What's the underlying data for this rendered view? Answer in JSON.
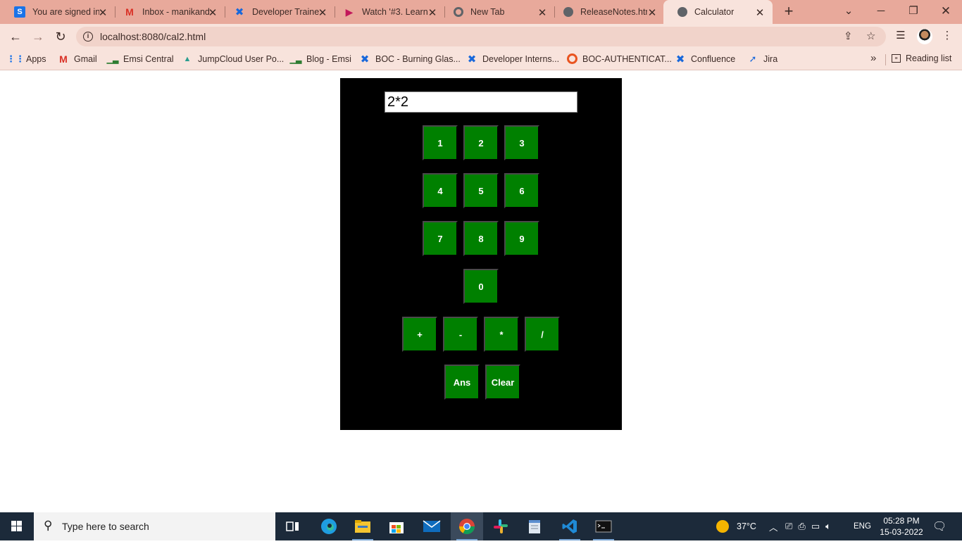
{
  "browser": {
    "tabs": [
      {
        "title": "You are signed in",
        "favicon": "S",
        "favicon_color": "#1a73e8"
      },
      {
        "title": "Inbox - manikand",
        "favicon": "M",
        "favicon_color": "#d93025"
      },
      {
        "title": "Developer Trainee",
        "favicon": "confluence-icon",
        "favicon_color": "#1868db"
      },
      {
        "title": "Watch '#3. Learn",
        "favicon": "play-icon",
        "favicon_color": "#c2185b"
      },
      {
        "title": "New Tab",
        "favicon": "chrome-icon",
        "favicon_color": "#5f6368"
      },
      {
        "title": "ReleaseNotes.htm",
        "favicon": "globe-icon",
        "favicon_color": "#5f6368"
      },
      {
        "title": "Calculator",
        "favicon": "globe-icon",
        "favicon_color": "#5f6368",
        "active": true
      }
    ],
    "new_tab": "+",
    "url": "localhost:8080/cal2.html",
    "bookmarks": [
      {
        "label": "Apps"
      },
      {
        "label": "Gmail"
      },
      {
        "label": "Emsi Central"
      },
      {
        "label": "JumpCloud User Po..."
      },
      {
        "label": "Blog - Emsi"
      },
      {
        "label": "BOC - Burning Glas..."
      },
      {
        "label": "Developer Interns..."
      },
      {
        "label": "BOC-AUTHENTICAT..."
      },
      {
        "label": "Confluence"
      },
      {
        "label": "Jira"
      }
    ],
    "bookmarks_more": "»",
    "reading_list": "Reading list"
  },
  "calculator": {
    "display_value": "2*2",
    "keys": {
      "k1": "1",
      "k2": "2",
      "k3": "3",
      "k4": "4",
      "k5": "5",
      "k6": "6",
      "k7": "7",
      "k8": "8",
      "k9": "9",
      "k0": "0",
      "plus": "+",
      "minus": "-",
      "times": "*",
      "divide": "/",
      "ans": "Ans",
      "clear": "Clear"
    },
    "colors": {
      "background": "#000000",
      "key": "#008000",
      "key_text": "#ffffff"
    }
  },
  "taskbar": {
    "search_placeholder": "Type here to search",
    "weather": "37°C",
    "language": "ENG",
    "time": "05:28 PM",
    "date": "15-03-2022"
  },
  "theme": {
    "tabstrip": "#e8a99b",
    "toolbar": "#f8e3dc",
    "taskbar": "#1c2a3a"
  }
}
